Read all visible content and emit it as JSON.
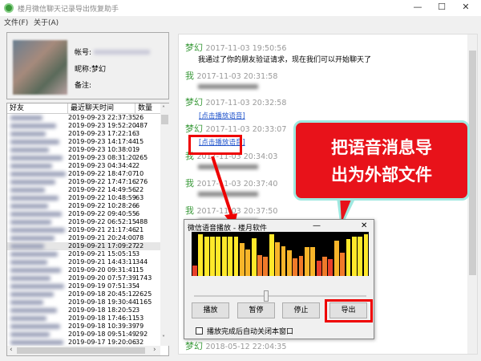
{
  "window": {
    "title": "楼月微信聊天记录导出恢复助手",
    "minimize": "—",
    "maximize": "☐",
    "close": "✕"
  },
  "menu": [
    "文件(F)",
    "关于(A)"
  ],
  "profile": {
    "account_label": "帐号:",
    "nickname_label": "昵称:",
    "nickname": "梦幻",
    "remark_label": "备注:"
  },
  "list": {
    "headers": [
      "好友",
      "最近聊天时间",
      "数量"
    ],
    "rows": [
      [
        "2019-09-23 22:37:35",
        "26"
      ],
      [
        "2019-09-23 19:52:20",
        "487"
      ],
      [
        "2019-09-23 17:22:16",
        "3"
      ],
      [
        "2019-09-23 14:17:44",
        "15"
      ],
      [
        "2019-09-23 10:38:01",
        "9"
      ],
      [
        "2019-09-23 08:31:20",
        "265"
      ],
      [
        "2019-09-23 04:34:42",
        "2"
      ],
      [
        "2019-09-22 18:47:07",
        "10"
      ],
      [
        "2019-09-22 17:47:16",
        "276"
      ],
      [
        "2019-09-22 14:49:56",
        "22"
      ],
      [
        "2019-09-22 10:48:59",
        "63"
      ],
      [
        "2019-09-22 10:28:26",
        "6"
      ],
      [
        "2019-09-22 09:40:55",
        "6"
      ],
      [
        "2019-09-22 06:52:15",
        "488"
      ],
      [
        "2019-09-21 21:17:46",
        "21"
      ],
      [
        "2019-09-21 20:24:00",
        "78"
      ],
      [
        "2019-09-21 17:09:27",
        "22"
      ],
      [
        "2019-09-21 15:05:15",
        "3"
      ],
      [
        "2019-09-21 14:43:11",
        "344"
      ],
      [
        "2019-09-20 09:31:41",
        "15"
      ],
      [
        "2019-09-20 07:57:39",
        "1743"
      ],
      [
        "2019-09-19 07:51:35",
        "4"
      ],
      [
        "2019-09-18 20:45:12",
        "2625"
      ],
      [
        "2019-09-18 19:30:44",
        "1165"
      ],
      [
        "2019-09-18 18:20:52",
        "3"
      ],
      [
        "2019-09-18 17:46:11",
        "53"
      ],
      [
        "2019-09-18 10:39:39",
        "79"
      ],
      [
        "2019-09-18 09:51:49",
        "292"
      ],
      [
        "2019-09-17 19:20:06",
        "32"
      ]
    ],
    "selected_index": 16
  },
  "chat": {
    "messages": [
      {
        "who": "梦幻",
        "time": "2017-11-03 19:50:56",
        "text": "我通过了你的朋友验证请求，现在我们可以开始聊天了"
      },
      {
        "who": "我",
        "time": "2017-11-03 20:31:58"
      },
      {
        "who": "梦幻",
        "time": "2017-11-03 20:32:58",
        "link": "[点击播放语音]"
      },
      {
        "who": "梦幻",
        "time": "2017-11-03 20:33:07",
        "link": "[点击播放语音]"
      },
      {
        "who": "我",
        "time": "2017-11-03 20:34:03"
      },
      {
        "who": "我",
        "time": "2017-11-03 20:37:40"
      },
      {
        "who": "我",
        "time": "2017-11-03 20:37:50"
      },
      {
        "who": "梦幻",
        "time": "2018-05-12 22:04:35"
      }
    ]
  },
  "callout": {
    "line1": "把语音消息导",
    "line2": "出为外部文件"
  },
  "player": {
    "title": "微信语音播放 - 楼月软件",
    "minimize": "—",
    "close": "✕",
    "play": "播放",
    "pause": "暂停",
    "stop": "停止",
    "export": "导出",
    "autoclose_label": "播放完成后自动关闭本窗口",
    "autoclose_checked": false,
    "position": 0.42,
    "levels": [
      0.25,
      1,
      0.95,
      0.95,
      0.95,
      0.95,
      0.95,
      0.95,
      0.78,
      0.64,
      0.9,
      0.5,
      0.46,
      1,
      0.8,
      0.72,
      0.62,
      0.43,
      0.48,
      0.7,
      0.7,
      0.36,
      0.46,
      0.4,
      0.85,
      0.56,
      0.88,
      0.95,
      0.95,
      1
    ]
  }
}
